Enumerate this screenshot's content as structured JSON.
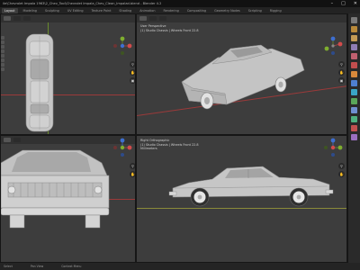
{
  "window": {
    "title": "ile\\Chevrolet Impala 1963\\2_Chev_Tool\\Chevrolet Impala_Chev_Clean_Impalad.blend - Blender 4.2",
    "minimize": "–",
    "maximize": "□",
    "close": "✕"
  },
  "tabs": [
    {
      "label": "Layout",
      "active": true
    },
    {
      "label": "Modeling",
      "active": false
    },
    {
      "label": "Sculpting",
      "active": false
    },
    {
      "label": "UV Editing",
      "active": false
    },
    {
      "label": "Texture Paint",
      "active": false
    },
    {
      "label": "Shading",
      "active": false
    },
    {
      "label": "Animation",
      "active": false
    },
    {
      "label": "Rendering",
      "active": false
    },
    {
      "label": "Compositing",
      "active": false
    },
    {
      "label": "Geometry Nodes",
      "active": false
    },
    {
      "label": "Scripting",
      "active": false
    },
    {
      "label": "Rigging",
      "active": false
    }
  ],
  "viewports": {
    "top": {
      "name": "top-orthographic"
    },
    "perspective": {
      "info_line1": "User Perspective",
      "info_line2": "(1) Studio Chassis | Wheels Front 22.8"
    },
    "front": {
      "name": "front-orthographic"
    },
    "right": {
      "info_line1": "Right Orthographic",
      "info_line2": "(1) Studio Chassis | Wheels Front 22.8",
      "info_line3": "Millimeters"
    }
  },
  "statusbar": {
    "select": "Select",
    "pan": "Pan View",
    "context": "Context Menu"
  },
  "colors": {
    "viewport_bg": "#3d3d3d",
    "car_body": "#c9c9c9",
    "axis_x": "#9b3a3a",
    "axis_y": "#6a8c2d"
  }
}
